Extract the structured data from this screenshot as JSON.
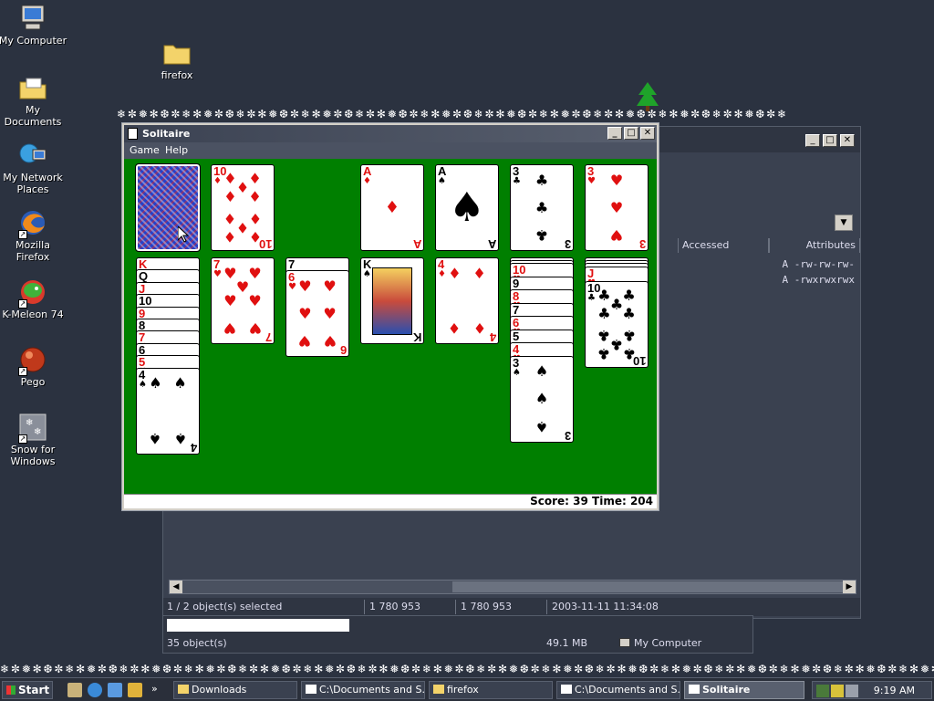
{
  "colors": {
    "felt": "#007f00",
    "desktop": "#2b3240",
    "red_suit": "#e01010"
  },
  "desktop": {
    "icons": [
      {
        "label": "My Computer",
        "icon": "computer-icon"
      },
      {
        "label": "My Documents",
        "icon": "folder-documents-icon"
      },
      {
        "label": "My Network Places",
        "icon": "network-places-icon"
      },
      {
        "label": "Mozilla Firefox",
        "icon": "firefox-icon"
      },
      {
        "label": "K-Meleon 74",
        "icon": "kmeleon-icon"
      },
      {
        "label": "Pego",
        "icon": "pego-icon"
      },
      {
        "label": "Snow for Windows",
        "icon": "snow-icon"
      },
      {
        "label": "firefox",
        "icon": "folder-icon"
      }
    ]
  },
  "explorer": {
    "columns": {
      "accessed": "Accessed",
      "attributes": "Attributes"
    },
    "rows": [
      "A -rw-rw-rw-",
      "A -rwxrwxrwx"
    ],
    "status": {
      "selected": "1 / 2 object(s) selected",
      "size1": "1 780 953",
      "size2": "1 780 953",
      "date": "2003-11-11 11:34:08"
    },
    "status2": {
      "objects": "35 object(s)",
      "size": "49.1 MB",
      "location": "My Computer"
    }
  },
  "solitaire": {
    "title": "Solitaire",
    "menu": {
      "game": "Game",
      "help": "Help"
    },
    "status": "Score: 39 Time: 204",
    "score": 39,
    "time": 204
  },
  "cards": {
    "waste": {
      "rank": "10",
      "suit": "♦"
    },
    "f1": {
      "rank": "A",
      "suit": "♦"
    },
    "f2": {
      "rank": "A",
      "suit": "♠"
    },
    "f3": {
      "rank": "3",
      "suit": "♣"
    },
    "f4": {
      "rank": "3",
      "suit": "♥"
    },
    "t1": [
      {
        "rank": "K",
        "suit": "♥"
      },
      {
        "rank": "Q",
        "suit": "♣"
      },
      {
        "rank": "J",
        "suit": "♥"
      },
      {
        "rank": "10",
        "suit": "♠"
      },
      {
        "rank": "9",
        "suit": "♥"
      },
      {
        "rank": "8",
        "suit": "♠"
      },
      {
        "rank": "7",
        "suit": "♥"
      },
      {
        "rank": "6",
        "suit": "♠"
      },
      {
        "rank": "5",
        "suit": "♥"
      },
      {
        "rank": "4",
        "suit": "♠"
      }
    ],
    "t2": {
      "rank": "7",
      "suit": "♥"
    },
    "t3": [
      {
        "rank": "7",
        "suit": "♠"
      },
      {
        "rank": "6",
        "suit": "♥"
      }
    ],
    "t4": {
      "rank": "K",
      "suit": "♠"
    },
    "t5": {
      "rank": "4",
      "suit": "♦"
    },
    "t6": [
      {
        "rank": "10",
        "suit": "♥"
      },
      {
        "rank": "9",
        "suit": "♠"
      },
      {
        "rank": "8",
        "suit": "♥"
      },
      {
        "rank": "7",
        "suit": "♠"
      },
      {
        "rank": "6",
        "suit": "♥"
      },
      {
        "rank": "5",
        "suit": "♠"
      },
      {
        "rank": "4",
        "suit": "♥"
      },
      {
        "rank": "3",
        "suit": "♠"
      }
    ],
    "t7": [
      {
        "rank": "J",
        "suit": "♥"
      },
      {
        "rank": "10",
        "suit": "♣"
      }
    ]
  },
  "taskbar": {
    "start": "Start",
    "buttons": [
      {
        "label": "Downloads",
        "icon": "folder-icon"
      },
      {
        "label": "C:\\Documents and S...",
        "icon": "7zip-icon"
      },
      {
        "label": "firefox",
        "icon": "folder-icon"
      },
      {
        "label": "C:\\Documents and S...",
        "icon": "7zip-icon"
      },
      {
        "label": "Solitaire",
        "icon": "solitaire-icon"
      }
    ],
    "clock": "9:19 AM"
  }
}
